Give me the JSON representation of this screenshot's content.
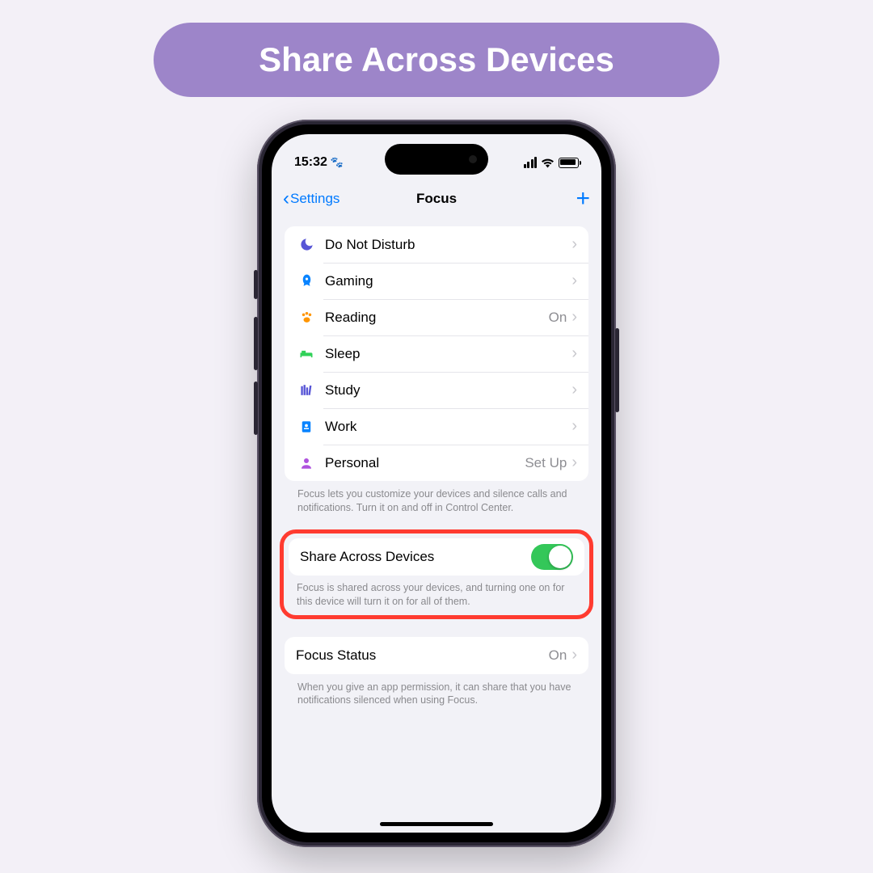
{
  "banner": {
    "title": "Share Across Devices"
  },
  "status": {
    "time": "15:32"
  },
  "nav": {
    "back": "Settings",
    "title": "Focus"
  },
  "focus_rows": [
    {
      "icon": "moon",
      "label": "Do Not Disturb",
      "value": ""
    },
    {
      "icon": "rocket",
      "label": "Gaming",
      "value": ""
    },
    {
      "icon": "paw",
      "label": "Reading",
      "value": "On"
    },
    {
      "icon": "bed",
      "label": "Sleep",
      "value": ""
    },
    {
      "icon": "study",
      "label": "Study",
      "value": ""
    },
    {
      "icon": "work",
      "label": "Work",
      "value": ""
    },
    {
      "icon": "person",
      "label": "Personal",
      "value": "Set Up"
    }
  ],
  "focus_footer": "Focus lets you customize your devices and silence calls and notifications. Turn it on and off in Control Center.",
  "share": {
    "label": "Share Across Devices",
    "on": true,
    "footer": "Focus is shared across your devices, and turning one on for this device will turn it on for all of them."
  },
  "status_row": {
    "label": "Focus Status",
    "value": "On",
    "footer": "When you give an app permission, it can share that you have notifications silenced when using Focus."
  }
}
